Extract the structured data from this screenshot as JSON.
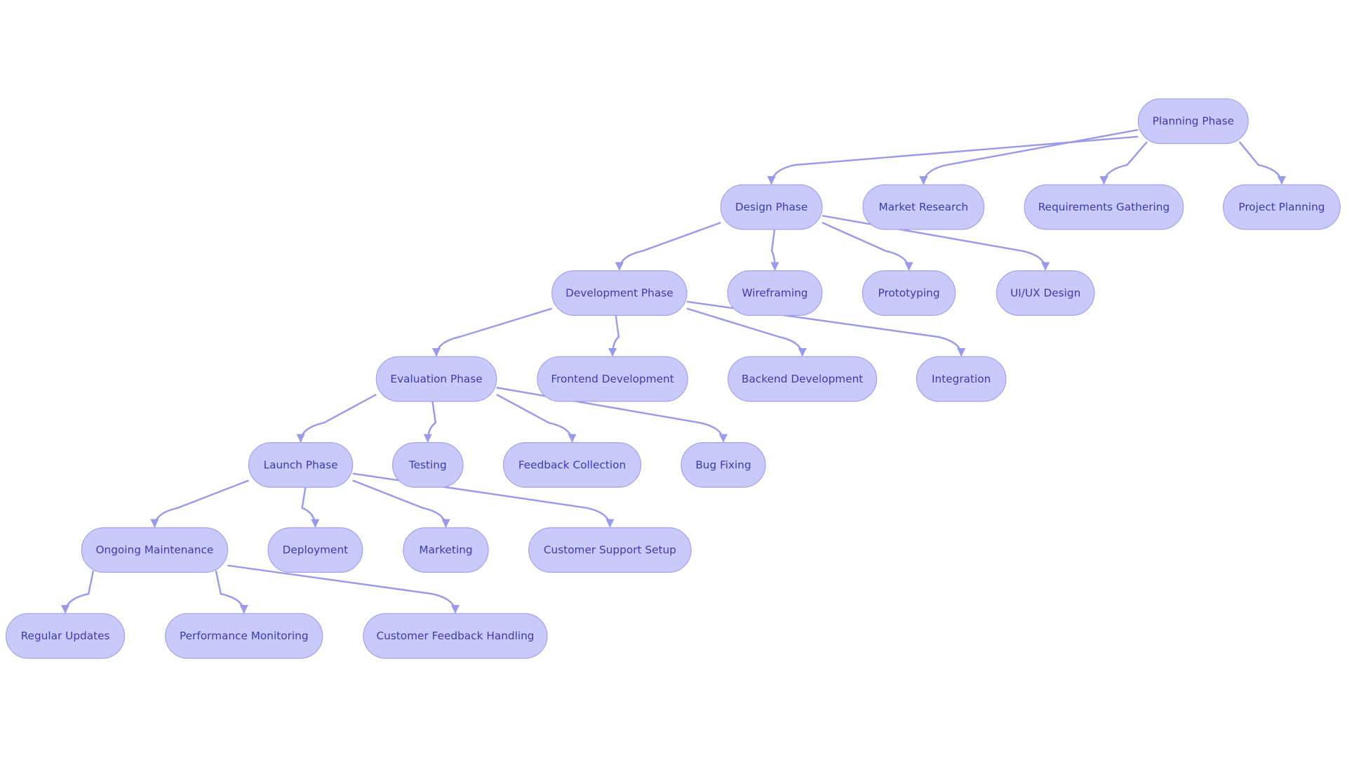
{
  "colors": {
    "node_fill": "#c9c9fb",
    "node_stroke": "#a3a3ec",
    "text": "#3b3bb0",
    "edge": "#9a9aea"
  },
  "nodes": [
    {
      "id": "planning",
      "label": "Planning Phase"
    },
    {
      "id": "design",
      "label": "Design Phase"
    },
    {
      "id": "market",
      "label": "Market Research"
    },
    {
      "id": "requirements",
      "label": "Requirements Gathering"
    },
    {
      "id": "projplan",
      "label": "Project Planning"
    },
    {
      "id": "development",
      "label": "Development Phase"
    },
    {
      "id": "wireframing",
      "label": "Wireframing"
    },
    {
      "id": "prototyping",
      "label": "Prototyping"
    },
    {
      "id": "uiux",
      "label": "UI/UX Design"
    },
    {
      "id": "evaluation",
      "label": "Evaluation Phase"
    },
    {
      "id": "frontend",
      "label": "Frontend Development"
    },
    {
      "id": "backend",
      "label": "Backend Development"
    },
    {
      "id": "integration",
      "label": "Integration"
    },
    {
      "id": "launch",
      "label": "Launch Phase"
    },
    {
      "id": "testing",
      "label": "Testing"
    },
    {
      "id": "feedback",
      "label": "Feedback Collection"
    },
    {
      "id": "bugfix",
      "label": "Bug Fixing"
    },
    {
      "id": "maintenance",
      "label": "Ongoing Maintenance"
    },
    {
      "id": "deployment",
      "label": "Deployment"
    },
    {
      "id": "marketing",
      "label": "Marketing"
    },
    {
      "id": "support",
      "label": "Customer Support Setup"
    },
    {
      "id": "updates",
      "label": "Regular Updates"
    },
    {
      "id": "perf",
      "label": "Performance Monitoring"
    },
    {
      "id": "custfeedback",
      "label": "Customer Feedback Handling"
    }
  ],
  "edges": [
    [
      "planning",
      "design"
    ],
    [
      "planning",
      "market"
    ],
    [
      "planning",
      "requirements"
    ],
    [
      "planning",
      "projplan"
    ],
    [
      "design",
      "development"
    ],
    [
      "design",
      "wireframing"
    ],
    [
      "design",
      "prototyping"
    ],
    [
      "design",
      "uiux"
    ],
    [
      "development",
      "evaluation"
    ],
    [
      "development",
      "frontend"
    ],
    [
      "development",
      "backend"
    ],
    [
      "development",
      "integration"
    ],
    [
      "evaluation",
      "launch"
    ],
    [
      "evaluation",
      "testing"
    ],
    [
      "evaluation",
      "feedback"
    ],
    [
      "evaluation",
      "bugfix"
    ],
    [
      "launch",
      "maintenance"
    ],
    [
      "launch",
      "deployment"
    ],
    [
      "launch",
      "marketing"
    ],
    [
      "launch",
      "support"
    ],
    [
      "maintenance",
      "updates"
    ],
    [
      "maintenance",
      "perf"
    ],
    [
      "maintenance",
      "custfeedback"
    ]
  ]
}
